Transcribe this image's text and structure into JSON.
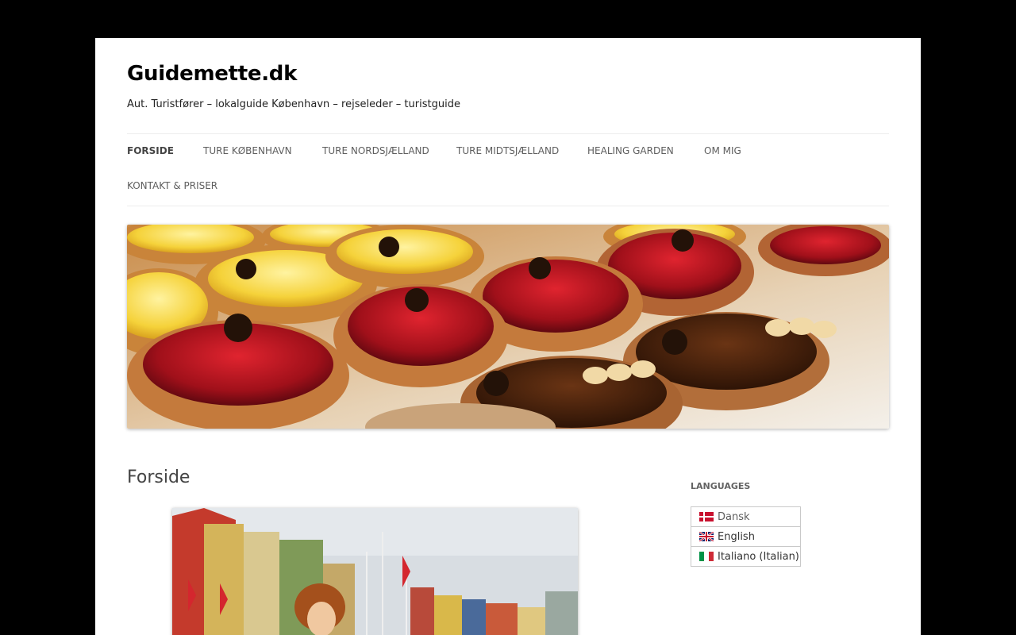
{
  "site": {
    "title": "Guidemette.dk",
    "tagline": "Aut. Turistfører – lokalguide København – rejseleder – turistguide"
  },
  "nav": {
    "items": [
      {
        "label": "Forside",
        "active": true
      },
      {
        "label": "Ture København"
      },
      {
        "label": "Ture Nordsjælland"
      },
      {
        "label": "Ture Midtsjælland"
      },
      {
        "label": "Healing Garden"
      },
      {
        "label": "Om mig"
      },
      {
        "label": "Kontakt & Priser"
      }
    ]
  },
  "header_image": {
    "subject": "fruit-tarts-display"
  },
  "main": {
    "page_title": "Forside",
    "photo": {
      "subject": "nyhavn-portrait"
    }
  },
  "sidebar": {
    "widget_title": "Languages",
    "languages": [
      {
        "label": "Dansk",
        "flag": "denmark-flag-icon",
        "current": true
      },
      {
        "label": "English",
        "flag": "uk-flag-icon"
      },
      {
        "label": "Italiano (Italian)",
        "flag": "italy-flag-icon"
      }
    ]
  },
  "colors": {
    "background": "#000000",
    "page": "#ffffff",
    "nav_text": "#5e5e5e",
    "border": "#ededed"
  }
}
